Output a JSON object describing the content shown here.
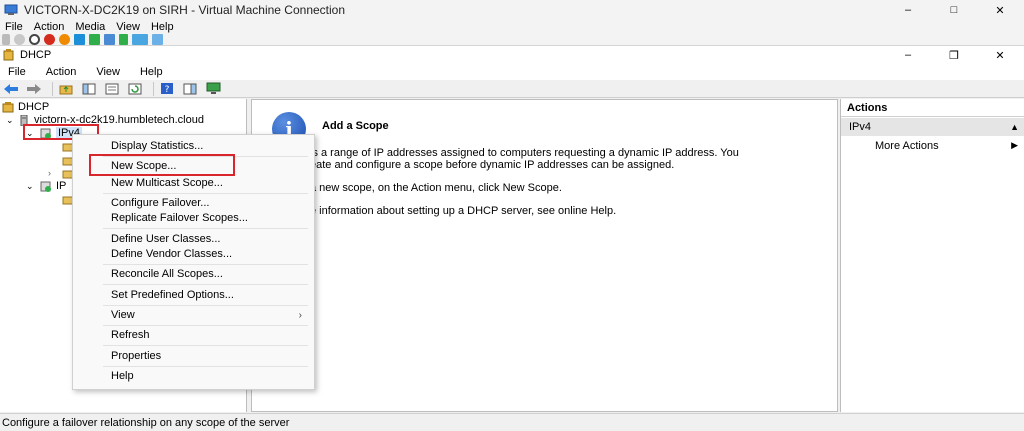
{
  "vm_window": {
    "title": "VICTORN-X-DC2K19 on SIRH - Virtual Machine Connection",
    "menu": [
      "File",
      "Action",
      "Media",
      "View",
      "Help"
    ],
    "controls": {
      "minimize": "–",
      "maximize": "□",
      "close": "✕"
    }
  },
  "mmc_window": {
    "title": "DHCP",
    "menu": [
      "File",
      "Action",
      "View",
      "Help"
    ],
    "controls": {
      "minimize": "–",
      "restore": "❐",
      "close": "✕"
    }
  },
  "tree": {
    "root": "DHCP",
    "server": "victorn-x-dc2k19.humbletech.cloud",
    "ipv4": "IPv4",
    "ipv6_partial": "IP"
  },
  "main": {
    "title": "Add a Scope",
    "lines": [
      "is a range of IP addresses assigned to computers requesting a dynamic IP address. You",
      "eate and configure a scope before dynamic IP addresses can be assigned.",
      "a new scope, on the Action menu, click New Scope.",
      "e information about setting up a DHCP server, see online Help."
    ]
  },
  "actions": {
    "header": "Actions",
    "selected": "IPv4",
    "more": "More Actions"
  },
  "context_menu": {
    "items": [
      "Display Statistics...",
      "New Scope...",
      "New Multicast Scope...",
      "Configure Failover...",
      "Replicate Failover Scopes...",
      "Define User Classes...",
      "Define Vendor Classes...",
      "Reconcile All Scopes...",
      "Set Predefined Options...",
      "View",
      "Refresh",
      "Properties",
      "Help"
    ]
  },
  "status": "Configure a failover relationship on any scope of the server",
  "colors": {
    "highlight": "#d9262c",
    "selection": "#e5e5e5",
    "info_blue": "#1a4db2"
  }
}
